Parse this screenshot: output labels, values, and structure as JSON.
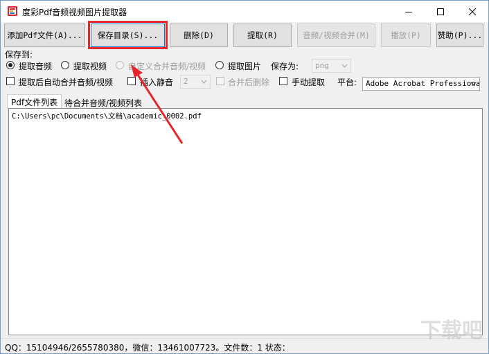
{
  "window": {
    "title": "度彩Pdf音频视频图片提取器",
    "controls": {
      "minimize_icon": "minimize-icon",
      "maximize_icon": "maximize-icon",
      "close_icon": "close-icon"
    }
  },
  "toolbar": {
    "add_pdf": "添加Pdf文件(A)...",
    "save_dir": "保存目录(S)...",
    "delete": "删除(D)",
    "extract": "提取(R)",
    "merge": "音频/视频合并(M)",
    "play": "播放(P)",
    "donate": "赞助(P)..."
  },
  "options": {
    "save_to_label": "保存到:",
    "radio_audio": "提取音频",
    "radio_video": "提取视频",
    "radio_custom": "自定义合并音频/视频",
    "radio_image": "提取图片",
    "save_as_label": "保存为:",
    "save_as_value": "png",
    "chk_auto_merge": "提取后自动合并音频/视频",
    "chk_insert_silence": "插入静音",
    "silence_value": "2",
    "chk_delete_after_merge": "合并后删除",
    "chk_manual_extract": "手动提取",
    "platform_label": "平台:",
    "platform_value": "Adobe Acrobat Professional"
  },
  "tabs": {
    "pdf_list": "Pdf文件列表",
    "merge_list": "待合并音频/视频列表"
  },
  "files": [
    "C:\\Users\\pc\\Documents\\文档\\academic_0002.pdf"
  ],
  "status": {
    "text": "QQ：15104946/2655780380，微信：13461007723。文件数：1  状态："
  },
  "watermark": "下载吧",
  "colors": {
    "highlight_box": "#e5262b",
    "annotation_arrow": "#e5262b",
    "focus_border": "#0078d7"
  }
}
